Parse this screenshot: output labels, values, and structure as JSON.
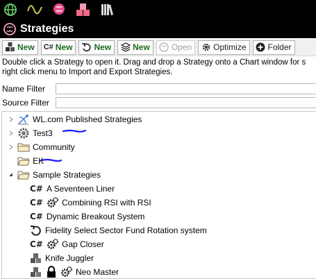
{
  "title": "Strategies",
  "toolbar": {
    "new1": "New",
    "new2": "New",
    "new3": "New",
    "new4": "New",
    "csharp_prefix": "C#",
    "open": "Open",
    "optimize": "Optimize",
    "folder": "Folder"
  },
  "description": {
    "line1": "Double click a Strategy to open it. Drag and drop a Strategy onto a Chart window for s",
    "line2": "right click menu to Import and Export Strategies."
  },
  "filters": {
    "name_label": "Name Filter",
    "name_value": "",
    "source_label": "Source Filter",
    "source_value": ""
  },
  "tree": {
    "items": [
      {
        "label": "WL.com Published Strategies"
      },
      {
        "label": "Test3"
      },
      {
        "label": "Community"
      },
      {
        "label": "EK"
      },
      {
        "label": "Sample Strategies"
      },
      {
        "label": "A Seventeen Liner"
      },
      {
        "label": "Combining RSI with RSI"
      },
      {
        "label": "Dynamic Breakout System"
      },
      {
        "label": "Fidelity Select Sector Fund Rotation system"
      },
      {
        "label": "Gap Closer"
      },
      {
        "label": "Knife Juggler"
      },
      {
        "label": "Neo Master"
      }
    ],
    "csharp_mark": "C#"
  },
  "colors": {
    "header_bg": "#000000",
    "brain_pink": "#f4a6c8",
    "new_green": "#1d6b1d",
    "annotation_blue": "#1a1aff"
  }
}
